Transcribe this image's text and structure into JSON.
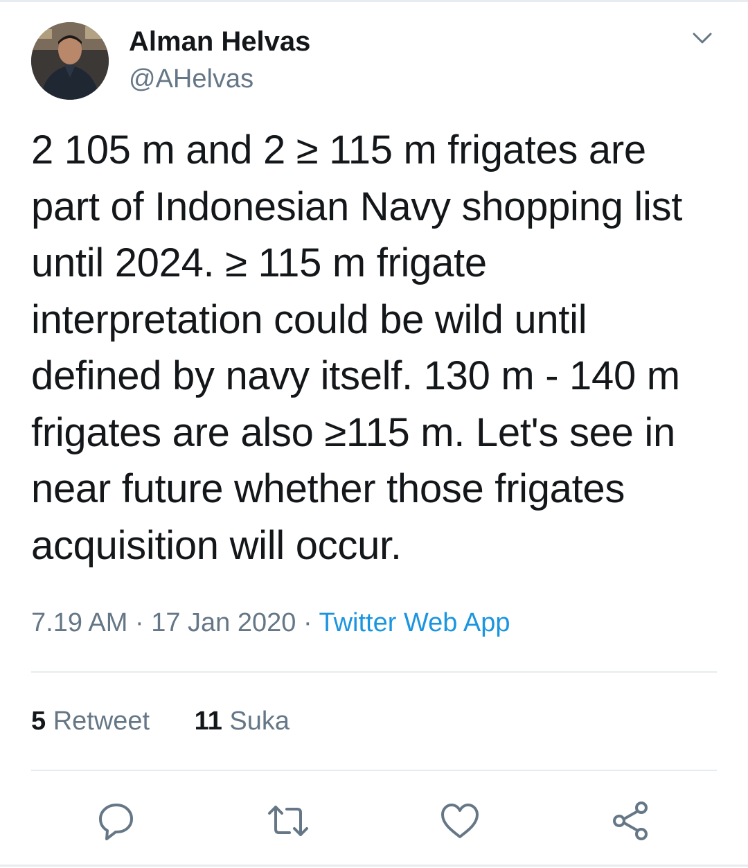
{
  "tweet": {
    "author": {
      "name": "Alman Helvas",
      "handle": "@AHelvas",
      "avatar_icon": "profile-photo"
    },
    "text": "2 105 m and 2 ≥ 115 m frigates are part of Indonesian Navy shopping list until 2024. ≥ 115 m frigate interpretation could be wild until defined by navy itself. 130 m - 140 m frigates are also ≥115 m. Let's see in near future whether those frigates acquisition will occur.",
    "time": "7.19 AM",
    "separator": "·",
    "date": "17 Jan 2020",
    "source": "Twitter Web App"
  },
  "stats": {
    "retweets": {
      "count": "5",
      "label": "Retweet"
    },
    "likes": {
      "count": "11",
      "label": "Suka"
    }
  },
  "actions": {
    "reply_icon": "speech-bubble-icon",
    "retweet_icon": "retweet-arrows-icon",
    "like_icon": "heart-icon",
    "share_icon": "share-nodes-icon"
  },
  "colors": {
    "text": "#14171a",
    "secondary": "#657786",
    "link": "#1b95e0",
    "divider": "#e6ecf0",
    "icon": "#657786"
  }
}
